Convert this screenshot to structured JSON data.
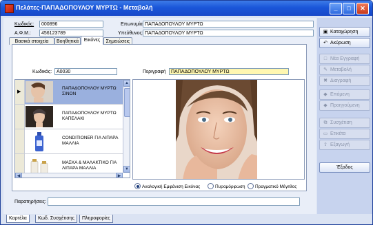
{
  "window": {
    "title": "Πελάτες-ΠΑΠΑΔΟΠΟΥΛΟΥ ΜΥΡΤΩ  -  Μεταβολή",
    "minimize": "_",
    "maximize": "□",
    "close": "✕"
  },
  "header": {
    "code_label": "Κωδικός:",
    "code_value": "000896",
    "afm_label": "Α.Φ.Μ.:",
    "afm_value": "456123789",
    "name_label": "Επωνυμία:",
    "name_value": "ΠΑΠΑΔΟΠΟΥΛΟΥ ΜΥΡΤΩ",
    "manager_label": "Υπεύθυνος:",
    "manager_value": "ΠΑΠΑΔΟΠΟΥΛΟΥ ΜΥΡΤΩ"
  },
  "tabs": [
    {
      "label": "Βασικά στοιχεία"
    },
    {
      "label": "Βοηθητικά"
    },
    {
      "label": "Εικόνες"
    },
    {
      "label": "Σημειώσεις"
    }
  ],
  "images_tab": {
    "code_label": "Κωδικός:",
    "code_value": "A0030",
    "description_label": "Περιγραφή",
    "description_value": "ΠΑΠΑΔΟΠΟΥΛΟΥ ΜΥΡΤΩ",
    "rows": [
      {
        "text": "ΠΑΠΑΔΟΠΟΥΛΟΥ ΜΥΡΤΩ ΣΙΝΟΝ",
        "thumb": "woman-profile-photo"
      },
      {
        "text": "ΠΑΠΑΔΟΠΟΥΛΟΥ ΜΥΡΤΩ ΚΑΠΕΛΑΚΙ",
        "thumb": "woman-portrait-photo"
      },
      {
        "text": "CONDITIONER ΓΙΑ ΛΙΠΑΡΑ ΜΑΛΛΙΑ",
        "thumb": "bottle-photo"
      },
      {
        "text": "ΜΑΣΚΑ & ΜΑΛΑΚΤΙΚΟ ΓΙΑ ΛΙΠΑΡΑ ΜΑΛΛΙΑ",
        "thumb": "bottles-photo"
      }
    ],
    "radio_options": [
      {
        "label": "Αναλογική Εμφάνιση Εικόνας",
        "checked": true
      },
      {
        "label": "Πυρομόρφωση",
        "checked": false
      },
      {
        "label": "Πραγματικό Μέγεθος",
        "checked": false
      }
    ],
    "notes_label": "Παρατηρήσεις:",
    "notes_value": ""
  },
  "toolbar": {
    "save": "Καταχώρηση",
    "cancel": "Ακύρωση",
    "new": "Νέα Εγγραφή",
    "edit": "Μεταβολή",
    "delete": "Διαγραφή",
    "next": "Επόμενη",
    "previous": "Προηγούμενη",
    "relation": "Συσχέτιση",
    "label": "Ετικέτα",
    "export": "Εξαγωγή",
    "exit": "Έξοδος"
  },
  "bottom_tabs": [
    {
      "label": "Καρτέλα"
    },
    {
      "label": "Κωδ. Συσχέτισης"
    },
    {
      "label": "Πληροφορίες"
    }
  ],
  "colors": {
    "title_bar": "#1a56d9",
    "selected_row": "#9ab0de",
    "yellow_field": "#fff7b0"
  }
}
